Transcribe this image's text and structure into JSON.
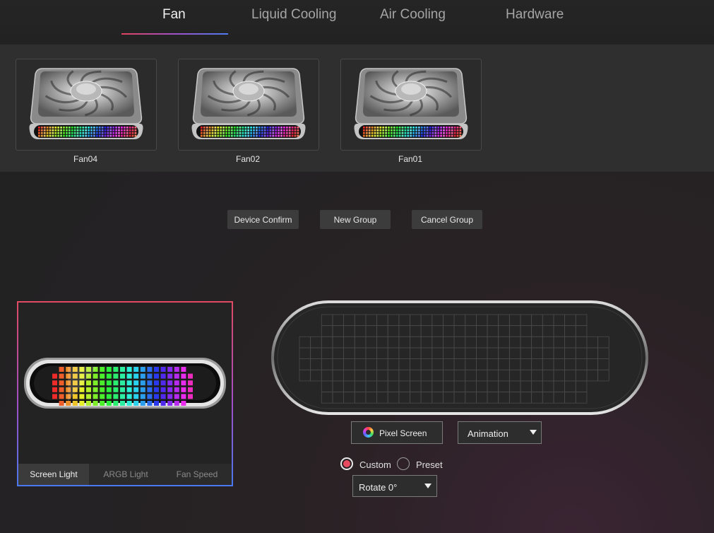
{
  "tabs": [
    {
      "label": "Fan",
      "active": true
    },
    {
      "label": "Liquid Cooling",
      "active": false
    },
    {
      "label": "Air Cooling",
      "active": false
    },
    {
      "label": "Hardware",
      "active": false
    }
  ],
  "fans": [
    {
      "label": "Fan04"
    },
    {
      "label": "Fan02"
    },
    {
      "label": "Fan01"
    }
  ],
  "actions": {
    "device_confirm": "Device Confirm",
    "new_group": "New Group",
    "cancel_group": "Cancel Group"
  },
  "preview": {
    "subtabs": [
      {
        "label": "Screen Light",
        "active": true
      },
      {
        "label": "ARGB Light",
        "active": false
      },
      {
        "label": "Fan Speed",
        "active": false
      }
    ]
  },
  "editor": {
    "pixel_screen_label": "Pixel Screen",
    "mode_select": "Animation",
    "radio_custom": "Custom",
    "radio_preset": "Preset",
    "radio_selected": "Custom",
    "rotate_select": "Rotate 0°"
  },
  "colors": {
    "accent_red": "#e84a60",
    "accent_purple": "#a050c8",
    "accent_blue": "#4c7cf0"
  }
}
